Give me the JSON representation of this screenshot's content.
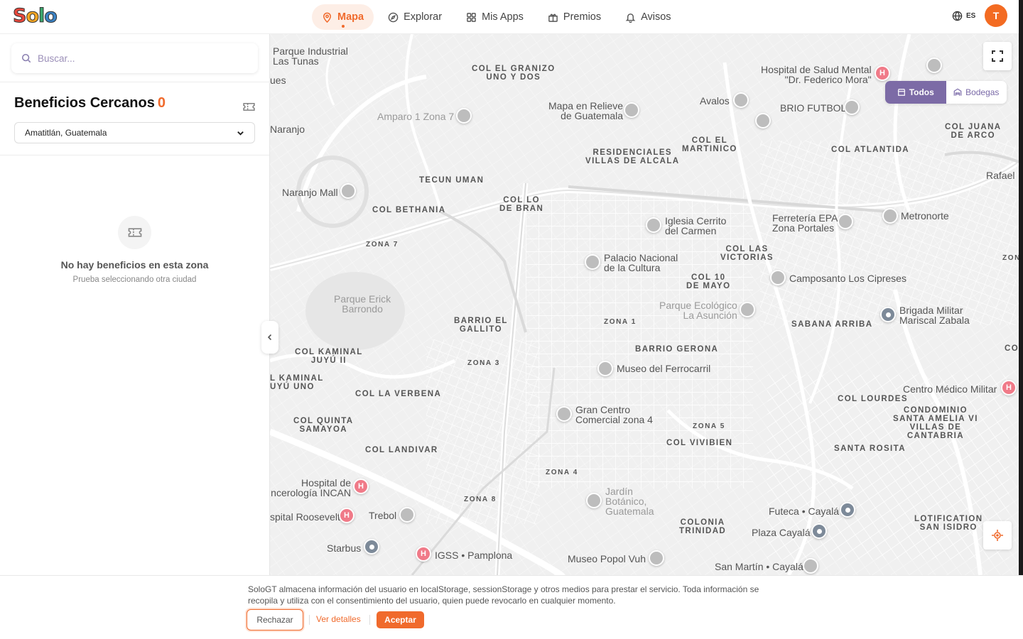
{
  "header": {
    "logo": {
      "letters": [
        "S",
        "o",
        "l",
        "o"
      ]
    },
    "nav": [
      {
        "label": "Mapa",
        "icon": "map-pin-icon",
        "active": true
      },
      {
        "label": "Explorar",
        "icon": "compass-icon",
        "active": false
      },
      {
        "label": "Mis Apps",
        "icon": "grid-icon",
        "active": false
      },
      {
        "label": "Premios",
        "icon": "gift-icon",
        "active": false
      },
      {
        "label": "Avisos",
        "icon": "bell-icon",
        "active": false
      }
    ],
    "language": "ES",
    "avatar_initial": "T"
  },
  "sidebar": {
    "search_placeholder": "Buscar...",
    "title": "Beneficios Cercanos",
    "count": "0",
    "city": "Amatitlán, Guatemala",
    "empty_title": "No hay beneficios en esta zona",
    "empty_subtitle": "Prueba seleccionando otra ciudad"
  },
  "map": {
    "toggle": {
      "all": "Todos",
      "warehouses": "Bodegas"
    },
    "place_labels": [
      "Parque Industrial\nLas Tunas",
      "ues",
      "Naranjo",
      "Amparo 1 Zona 7",
      "Naranjo Mall",
      "Mapa en Relieve\nde Guatemala",
      "Avalos",
      "Hospital de Salud Mental\n\"Dr. Federico Mora\"",
      "BRIO FUTBOL",
      "Rafael",
      "Iglesia Cerrito\ndel Carmen",
      "Ferretería EPA\nZona Portales",
      "Metronorte",
      "Palacio Nacional\nde la Cultura",
      "Camposanto Los Cipreses",
      "Parque Erick\nBarrondo",
      "Parque Ecológico\nLa Asunción",
      "Brigada Militar\nMariscal Zabala",
      "Museo del Ferrocarril",
      "Centro Médico Militar",
      "Gran Centro\nComercial zona 4",
      "Hospital de\nncerología INCAN",
      "spital Roosevelt",
      "Trebol",
      "Jardín\nBotánico,\nGuatemala",
      "Futeca • Cayalá",
      "Plaza Cayalá",
      "Starbus",
      "IGSS • Pamplona",
      "Museo Popol Vuh",
      "San Martín • Cayalá"
    ],
    "district_labels": [
      "COL EL GRANIZO\nUNO Y DOS",
      "COL EL\nMARTINICO",
      "RESIDENCIALES\nVILLAS DE ALCALA",
      "COL JUANA\nDE ARCO",
      "COL ATLANTIDA",
      "TECUN UMAN",
      "COL LO\nDE BRAN",
      "COL BETHANIA",
      "COL LAS\nVICTORIAS",
      "COL 10\nDE MAYO",
      "BARRIO EL\nGALLITO",
      "SABANA ARRIBA",
      "COL KAMINAL\nJUYÚ II",
      "BARRIO GERONA",
      "L KAMINAL\nUYÚ UNO",
      "COL LA VERBENA",
      "COL LOURDES",
      "CONDOMINIO\nSANTA AMELIA VI\nVILLAS DE\nCANTABRIA",
      "COL QUINTA\nSAMAYOA",
      "COL VIVIBIEN",
      "SANTA ROSITA",
      "COL LANDIVAR",
      "COLONIA\nTRINIDAD",
      "LOTIFICATION\nSAN ISIDRO",
      "CO"
    ],
    "zone_labels": [
      "ZONA 7",
      "ZONA 1",
      "ZONA 3",
      "ZONA 5",
      "ZONA 4",
      "ZONA 8",
      "ZON"
    ]
  },
  "cookie": {
    "text": "SoloGT almacena información del usuario en localStorage, sessionStorage y otros medios para prestar el servicio. Toda información se recopila y utiliza con el consentimiento del usuario, quien puede revocarlo en cualquier momento.",
    "reject": "Rechazar",
    "details": "Ver detalles",
    "accept": "Aceptar"
  }
}
